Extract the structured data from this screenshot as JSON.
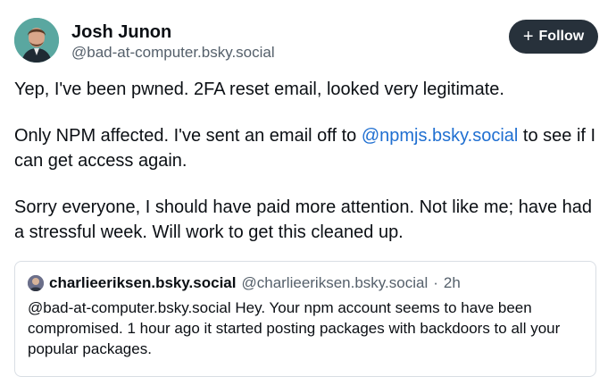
{
  "author": {
    "name": "Josh Junon",
    "handle": "@bad-at-computer.bsky.social"
  },
  "follow_button": {
    "icon": "plus-icon",
    "label": "Follow"
  },
  "post": {
    "paragraph1": "Yep, I've been pwned. 2FA reset email, looked very legitimate.",
    "paragraph2_before": "Only NPM affected. I've sent an email off to ",
    "paragraph2_mention": "@npmjs.bsky.social",
    "paragraph2_after": " to see if I can get access again.",
    "paragraph3": "Sorry everyone, I should have paid more attention. Not like me; have had a stressful week. Will work to get this cleaned up."
  },
  "quoted_post": {
    "author_name": "charlieeriksen.bsky.social",
    "author_handle": "@charlieeriksen.bsky.social",
    "separator": "·",
    "time": "2h",
    "text": "@bad-at-computer.bsky.social Hey. Your npm account seems to have been compromised. 1 hour ago it started posting packages with backdoors to all your popular packages."
  },
  "colors": {
    "follow_bg": "#27313b",
    "mention": "#1f6fd1",
    "muted": "#55606b"
  }
}
